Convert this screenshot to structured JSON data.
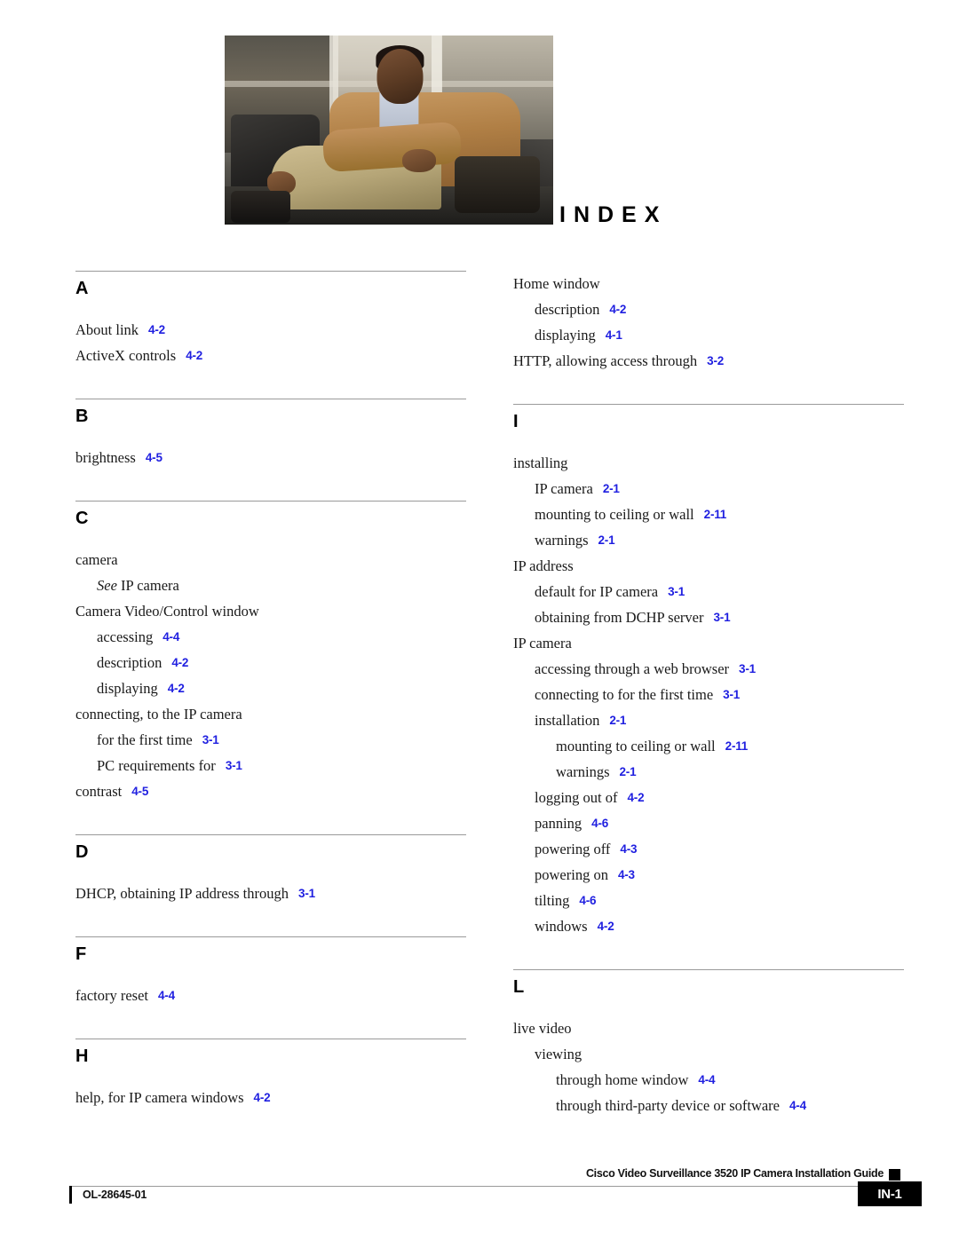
{
  "page": {
    "title": "INDEX"
  },
  "header_image": {
    "alt": "photo-seated-man-in-tan-jacket"
  },
  "columns": [
    {
      "id": "left",
      "sections": [
        {
          "letter": "A",
          "entries": [
            {
              "level": 0,
              "term": "About link",
              "pageref": "4-2"
            },
            {
              "level": 0,
              "term": "ActiveX controls",
              "pageref": "4-2"
            }
          ]
        },
        {
          "letter": "B",
          "entries": [
            {
              "level": 0,
              "term": "brightness",
              "pageref": "4-5"
            }
          ]
        },
        {
          "letter": "C",
          "entries": [
            {
              "level": 0,
              "term": "camera",
              "pageref": ""
            },
            {
              "level": 1,
              "term_italic": "See",
              "term": "IP camera",
              "pageref": ""
            },
            {
              "level": 0,
              "term": "Camera Video/Control window",
              "pageref": ""
            },
            {
              "level": 1,
              "term": "accessing",
              "pageref": "4-4"
            },
            {
              "level": 1,
              "term": "description",
              "pageref": "4-2"
            },
            {
              "level": 1,
              "term": "displaying",
              "pageref": "4-2"
            },
            {
              "level": 0,
              "term": "connecting, to the IP camera",
              "pageref": ""
            },
            {
              "level": 1,
              "term": "for the first time",
              "pageref": "3-1"
            },
            {
              "level": 1,
              "term": "PC requirements for",
              "pageref": "3-1"
            },
            {
              "level": 0,
              "term": "contrast",
              "pageref": "4-5"
            }
          ]
        },
        {
          "letter": "D",
          "entries": [
            {
              "level": 0,
              "term": "DHCP, obtaining IP address through",
              "pageref": "3-1"
            }
          ]
        },
        {
          "letter": "F",
          "entries": [
            {
              "level": 0,
              "term": "factory reset",
              "pageref": "4-4"
            }
          ]
        },
        {
          "letter": "H",
          "entries": [
            {
              "level": 0,
              "term": "help, for IP camera windows",
              "pageref": "4-2"
            }
          ]
        }
      ]
    },
    {
      "id": "right",
      "sections": [
        {
          "letter": "",
          "entries": [
            {
              "level": 0,
              "term": "Home window",
              "pageref": ""
            },
            {
              "level": 1,
              "term": "description",
              "pageref": "4-2"
            },
            {
              "level": 1,
              "term": "displaying",
              "pageref": "4-1"
            },
            {
              "level": 0,
              "term": "HTTP, allowing access through",
              "pageref": "3-2"
            }
          ]
        },
        {
          "letter": "I",
          "entries": [
            {
              "level": 0,
              "term": "installing",
              "pageref": ""
            },
            {
              "level": 1,
              "term": "IP camera",
              "pageref": "2-1"
            },
            {
              "level": 1,
              "term": "mounting to ceiling or wall",
              "pageref": "2-11"
            },
            {
              "level": 1,
              "term": "warnings",
              "pageref": "2-1"
            },
            {
              "level": 0,
              "term": "IP address",
              "pageref": ""
            },
            {
              "level": 1,
              "term": "default for IP camera",
              "pageref": "3-1"
            },
            {
              "level": 1,
              "term": "obtaining from DCHP server",
              "pageref": "3-1"
            },
            {
              "level": 0,
              "term": "IP camera",
              "pageref": ""
            },
            {
              "level": 1,
              "term": "accessing through a web browser",
              "pageref": "3-1"
            },
            {
              "level": 1,
              "term": "connecting to for the first time",
              "pageref": "3-1"
            },
            {
              "level": 1,
              "term": "installation",
              "pageref": "2-1"
            },
            {
              "level": 2,
              "term": "mounting to ceiling or wall",
              "pageref": "2-11"
            },
            {
              "level": 2,
              "term": "warnings",
              "pageref": "2-1"
            },
            {
              "level": 1,
              "term": "logging out of",
              "pageref": "4-2"
            },
            {
              "level": 1,
              "term": "panning",
              "pageref": "4-6"
            },
            {
              "level": 1,
              "term": "powering off",
              "pageref": "4-3"
            },
            {
              "level": 1,
              "term": "powering on",
              "pageref": "4-3"
            },
            {
              "level": 1,
              "term": "tilting",
              "pageref": "4-6"
            },
            {
              "level": 1,
              "term": "windows",
              "pageref": "4-2"
            }
          ]
        },
        {
          "letter": "L",
          "entries": [
            {
              "level": 0,
              "term": "live video",
              "pageref": ""
            },
            {
              "level": 1,
              "term": "viewing",
              "pageref": ""
            },
            {
              "level": 2,
              "term": "through home window",
              "pageref": "4-4"
            },
            {
              "level": 2,
              "term": "through third-party device or software",
              "pageref": "4-4"
            }
          ]
        }
      ]
    }
  ],
  "footer": {
    "title": "Cisco Video Surveillance 3520 IP Camera Installation Guide",
    "doc_id": "OL-28645-01",
    "page_number": "IN-1"
  },
  "colors": {
    "pageref_blue": "#1f1fe0",
    "rule_gray": "#9a9a9a",
    "text_black": "#1a1a1a"
  }
}
